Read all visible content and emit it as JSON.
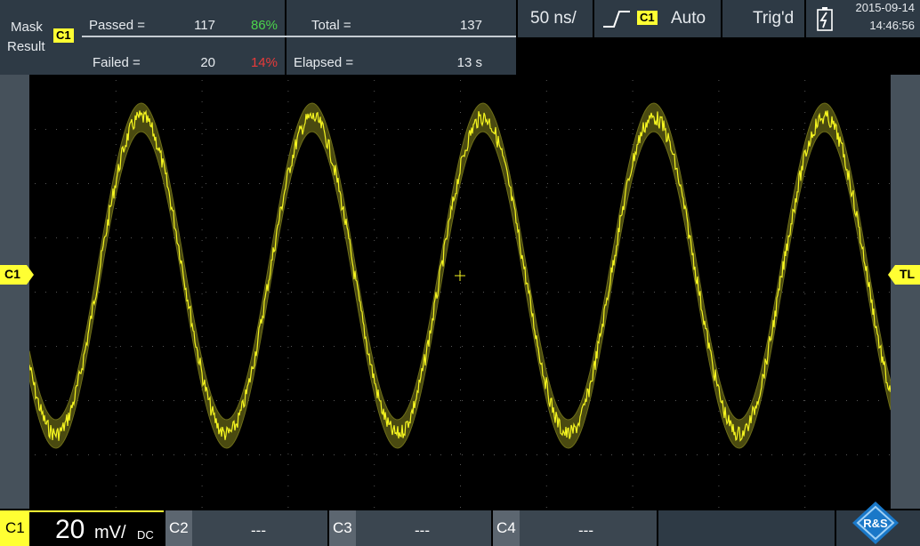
{
  "mask_result": {
    "title_line1": "Mask",
    "title_line2": "Result",
    "channel": "C1",
    "passed_label": "Passed =",
    "passed_count": "117",
    "passed_pct": "86%",
    "failed_label": "Failed =",
    "failed_count": "20",
    "failed_pct": "14%",
    "total_label": "Total =",
    "total_value": "137",
    "elapsed_label": "Elapsed =",
    "elapsed_value": "13 s"
  },
  "timebase": {
    "value": "50 ns/"
  },
  "trigger": {
    "slope_icon": "rising-edge-icon",
    "channel": "C1",
    "mode": "Auto",
    "status": "Trig'd"
  },
  "battery": {
    "icon": "battery-charging-icon"
  },
  "datetime": {
    "date": "2015-09-14",
    "time": "14:46:56"
  },
  "markers": {
    "left_channel": "C1",
    "right_trigger": "TL"
  },
  "bottom": {
    "c1_label": "C1",
    "c1_scale": "20",
    "c1_unit": "mV/",
    "c1_coupling": "DC",
    "c2_label": "C2",
    "c2_value": "---",
    "c3_label": "C3",
    "c3_value": "---",
    "c4_label": "C4",
    "c4_value": "---",
    "logo_text": "R&S"
  },
  "colors": {
    "trace": "#f5f520",
    "mask": "#4a4a10",
    "panel": "#2e3a45",
    "pass": "#4cd44c",
    "fail": "#e83a3a"
  }
}
